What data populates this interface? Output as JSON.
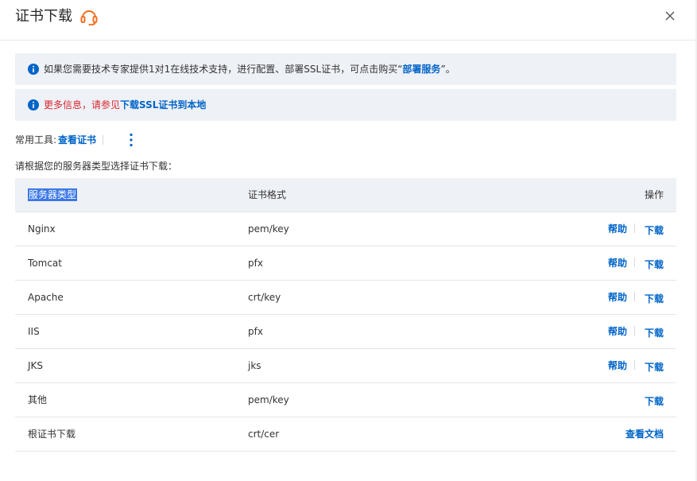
{
  "dialog": {
    "title": "证书下载",
    "brand_color": "#f26d21",
    "link_color": "#0064c8",
    "warning_color": "#d9262e"
  },
  "notices": {
    "notice1_text": "如果您需要技术专家提供1对1在线技术支持，进行配置、部署SSL证书，可点击购买“",
    "notice1_link": "部署服务",
    "notice1_tail": "”。",
    "notice2_text": "更多信息，请参见",
    "notice2_link": "下载SSL证书到本地"
  },
  "tools": {
    "label": "常用工具:",
    "view_cert": "查看证书"
  },
  "instruction": "请根据您的服务器类型选择证书下载：",
  "table": {
    "headers": {
      "type": "服务器类型",
      "format": "证书格式",
      "ops": "操作"
    },
    "rows": [
      {
        "type": "Nginx",
        "format": "pem/key",
        "help": "帮助",
        "download": "下载"
      },
      {
        "type": "Tomcat",
        "format": "pfx",
        "help": "帮助",
        "download": "下载"
      },
      {
        "type": "Apache",
        "format": "crt/key",
        "help": "帮助",
        "download": "下载"
      },
      {
        "type": "IIS",
        "format": "pfx",
        "help": "帮助",
        "download": "下载"
      },
      {
        "type": "JKS",
        "format": "jks",
        "help": "帮助",
        "download": "下载"
      },
      {
        "type": "其他",
        "format": "pem/key",
        "download": "下载"
      },
      {
        "type": "根证书下载",
        "format": "crt/cer",
        "doc": "查看文档"
      }
    ]
  }
}
